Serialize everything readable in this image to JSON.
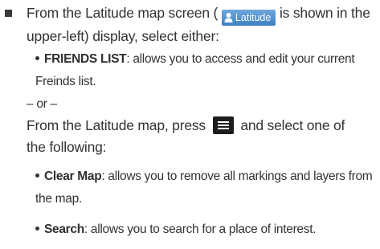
{
  "step": {
    "text_before": "From the Latitude map screen (",
    "badge_label": "Latitude",
    "text_after": "is shown in the upper-left) display, select either:"
  },
  "friends": {
    "term": "FRIENDS LIST",
    "desc": ": allows you to access and edit your current",
    "desc_line2": "Freinds list."
  },
  "or_label": "– or –",
  "menu_step": {
    "text_before": "From the Latitude map, press",
    "text_after": "and select one of",
    "text_line2": "the following:"
  },
  "options": [
    {
      "term": "Clear Map",
      "desc": ": allows you to remove all markings and layers from",
      "desc_line2": "the map."
    },
    {
      "term": "Search",
      "desc": ": allows you to search for a place of interest."
    }
  ],
  "icons": {
    "badge_icon": "person-pin-icon",
    "menu_key": "menu-key-icon"
  },
  "colors": {
    "badge": "#4a8ad0",
    "text": "#333333"
  }
}
